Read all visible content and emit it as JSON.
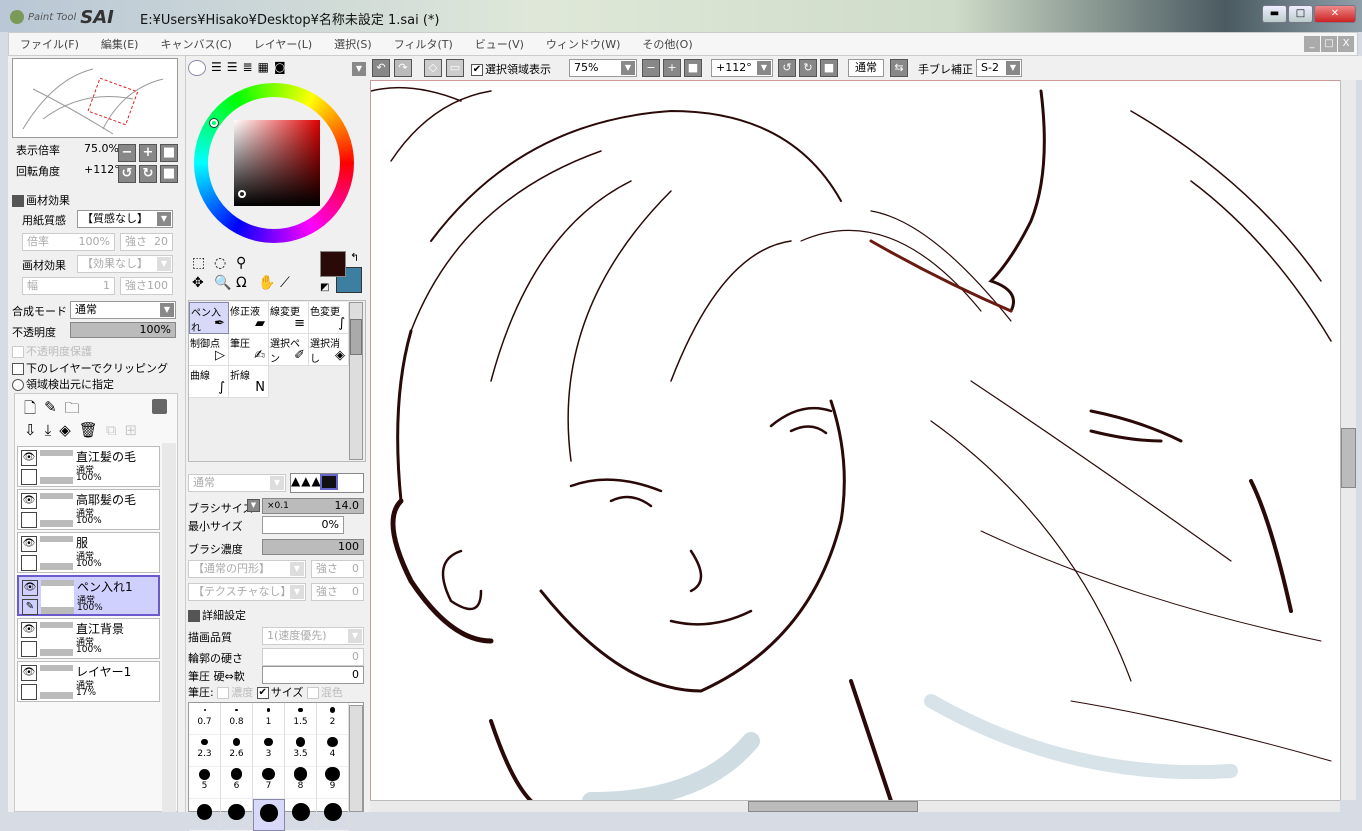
{
  "app": {
    "logo_small": "Paint Tool",
    "logo_big": "SAI",
    "title": "E:¥Users¥Hisako¥Desktop¥名称未設定 1.sai (*)"
  },
  "window_controls": [
    "minimize",
    "maximize",
    "close"
  ],
  "menu": [
    "ファイル(F)",
    "編集(E)",
    "キャンバス(C)",
    "レイヤー(L)",
    "選択(S)",
    "フィルタ(T)",
    "ビュー(V)",
    "ウィンドウ(W)",
    "その他(O)"
  ],
  "navigator": {
    "zoom_label": "表示倍率",
    "zoom_value": "75.0%",
    "rotate_label": "回転角度",
    "rotate_value": "+112°"
  },
  "texture": {
    "header": "画材効果",
    "paper_label": "用紙質感",
    "paper_value": "【質感なし】",
    "scale_label": "倍率",
    "scale_value": "100%",
    "strength_label": "強さ",
    "strength_value": "20",
    "effect_label": "画材効果",
    "effect_value": "【効果なし】",
    "width_label": "幅",
    "width_value": "1",
    "effect_strength_label": "強さ",
    "effect_strength_value": "100"
  },
  "layer_props": {
    "blend_label": "合成モード",
    "blend_value": "通常",
    "opacity_label": "不透明度",
    "opacity_value": "100%",
    "opacity_percent": 100,
    "protect_label": "不透明度保護",
    "clip_label": "下のレイヤーでクリッピング",
    "region_label": "領域検出元に指定"
  },
  "layers": [
    {
      "name": "直江髪の毛",
      "mode": "通常",
      "opacity": "100%",
      "selected": false
    },
    {
      "name": "高耶髪の毛",
      "mode": "通常",
      "opacity": "100%",
      "selected": false
    },
    {
      "name": "服",
      "mode": "通常",
      "opacity": "100%",
      "selected": false
    },
    {
      "name": "ペン入れ1",
      "mode": "通常",
      "opacity": "100%",
      "selected": true
    },
    {
      "name": "直江背景",
      "mode": "通常",
      "opacity": "100%",
      "selected": false
    },
    {
      "name": "レイヤー1",
      "mode": "通常",
      "opacity": "17%",
      "selected": false
    }
  ],
  "colors": {
    "primary": "#2a0a08",
    "secondary": "#3d7fa0",
    "accent": "#6a5acd"
  },
  "tools": [
    {
      "label": "ペン入れ",
      "icon": "pen-icon"
    },
    {
      "label": "修正液",
      "icon": "eraser-icon"
    },
    {
      "label": "線変更",
      "icon": "line-weight-icon"
    },
    {
      "label": "色変更",
      "icon": "color-change-icon"
    },
    {
      "label": "制御点",
      "icon": "cursor-icon"
    },
    {
      "label": "筆圧",
      "icon": "pressure-icon"
    },
    {
      "label": "選択ペン",
      "icon": "select-pen-icon"
    },
    {
      "label": "選択消し",
      "icon": "select-erase-icon"
    },
    {
      "label": "曲線",
      "icon": "curve-icon"
    },
    {
      "label": "折線",
      "icon": "polyline-icon"
    }
  ],
  "brush": {
    "mode_value": "通常",
    "size_label": "ブラシサイズ",
    "size_mult": "×0.1",
    "size_value": "14.0",
    "min_label": "最小サイズ",
    "min_value": "0%",
    "density_label": "ブラシ濃度",
    "density_value": "100",
    "shape_value": "【通常の円形】",
    "shape_strength_label": "強さ",
    "shape_strength_value": "0",
    "tex_value": "【テクスチャなし】",
    "tex_strength_label": "強さ",
    "tex_strength_value": "0",
    "detail_header": "詳細設定",
    "quality_label": "描画品質",
    "quality_value": "1(速度優先)",
    "hardness_label": "輪郭の硬さ",
    "hardness_value": "0",
    "pressure_hs_label": "筆圧 硬⇔軟",
    "pressure_hs_value": "0",
    "pressure_label": "筆圧:",
    "p_density": "濃度",
    "p_size": "サイズ",
    "p_blend": "混色",
    "p_size_checked": true
  },
  "brush_sizes": [
    "0.7",
    "0.8",
    "1",
    "1.5",
    "2",
    "2.3",
    "2.6",
    "3",
    "3.5",
    "4",
    "5",
    "6",
    "7",
    "8",
    "9"
  ],
  "toolbar": {
    "selection_show": "選択領域表示",
    "zoom": "75%",
    "rotate": "+112°",
    "blend": "通常",
    "stabilizer_label": "手ブレ補正",
    "stabilizer_value": "S-2"
  }
}
